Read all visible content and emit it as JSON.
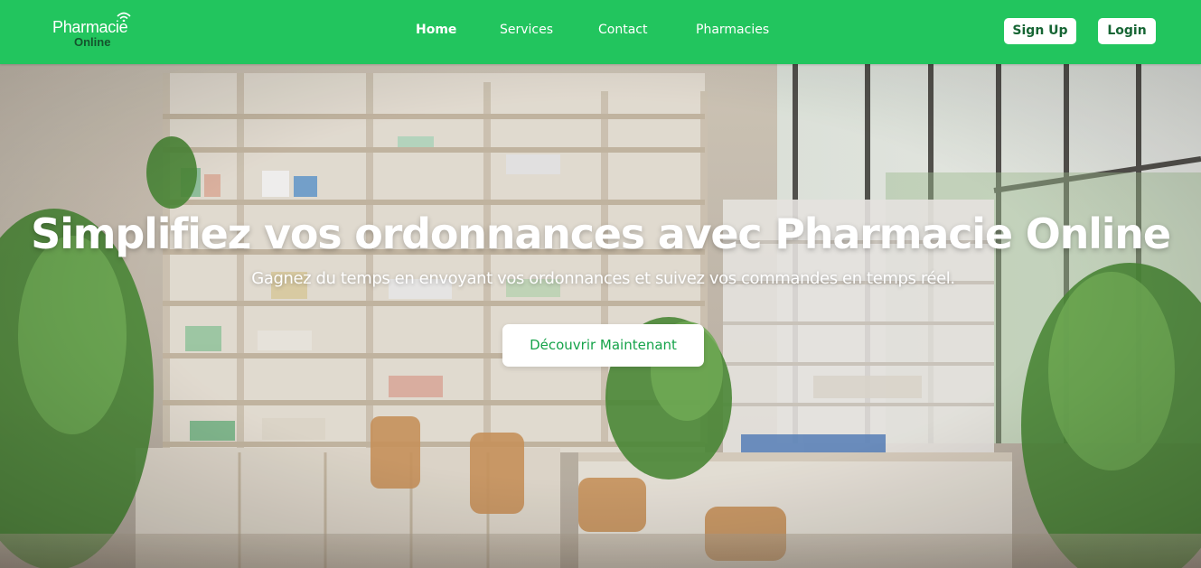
{
  "brand": {
    "name_line1": "Pharmacie",
    "name_line2": "Online",
    "logo_icon": "wifi-signal-icon"
  },
  "nav": {
    "items": [
      {
        "label": "Home",
        "active": true
      },
      {
        "label": "Services",
        "active": false
      },
      {
        "label": "Contact",
        "active": false
      },
      {
        "label": "Pharmacies",
        "active": false
      }
    ]
  },
  "auth": {
    "signup_label": "Sign Up",
    "login_label": "Login"
  },
  "hero": {
    "title": "Simplifiez vos ordonnances avec Pharmacie Online",
    "subtitle": "Gagnez du temps en envoyant vos ordonnances et suivez vos commandes en temps réel.",
    "cta_label": "Découvrir Maintenant",
    "background_image": "pharmacy-interior-photo"
  },
  "colors": {
    "brand_green": "#22c55e",
    "dark_green": "#166534",
    "cta_text_green": "#16a34a",
    "white": "#ffffff"
  }
}
